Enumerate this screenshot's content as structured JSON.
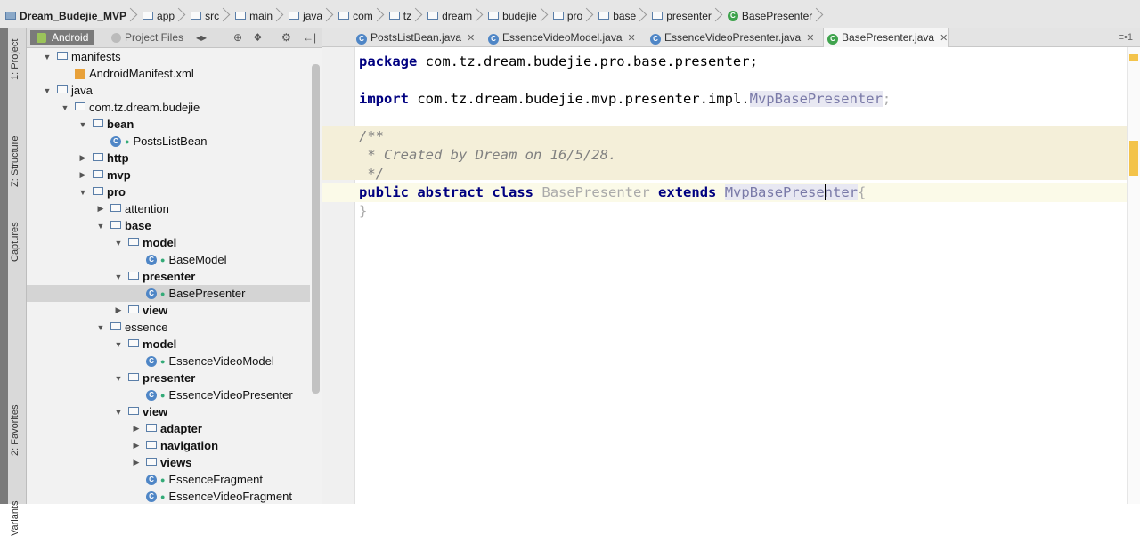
{
  "breadcrumb": {
    "items": [
      {
        "label": "Dream_Budejie_MVP",
        "icon": "project-folder-icon"
      },
      {
        "label": "app",
        "icon": "module-folder-icon"
      },
      {
        "label": "src",
        "icon": "folder-icon"
      },
      {
        "label": "main",
        "icon": "folder-icon"
      },
      {
        "label": "java",
        "icon": "folder-icon"
      },
      {
        "label": "com",
        "icon": "package-icon"
      },
      {
        "label": "tz",
        "icon": "package-icon"
      },
      {
        "label": "dream",
        "icon": "package-icon"
      },
      {
        "label": "budejie",
        "icon": "package-icon"
      },
      {
        "label": "pro",
        "icon": "package-icon"
      },
      {
        "label": "base",
        "icon": "package-icon"
      },
      {
        "label": "presenter",
        "icon": "package-icon"
      },
      {
        "label": "BasePresenter",
        "icon": "class-icon"
      }
    ]
  },
  "left_strip": {
    "tabs": [
      "1: Project",
      "Z: Structure",
      "Captures",
      "2: Favorites",
      "Variants"
    ]
  },
  "project_pane": {
    "view_tab": "Android",
    "other_tab": "Project Files",
    "tools": [
      "◂▸",
      "⊕",
      "❖",
      "⚙",
      "←|",
      "×"
    ]
  },
  "tree": [
    {
      "label": "manifests",
      "depth": 0,
      "expanded": true,
      "kind": "folder",
      "bold": false
    },
    {
      "label": "AndroidManifest.xml",
      "depth": 1,
      "kind": "file",
      "leaf": true
    },
    {
      "label": "java",
      "depth": 0,
      "expanded": true,
      "kind": "folder"
    },
    {
      "label": "com.tz.dream.budejie",
      "depth": 1,
      "expanded": true,
      "kind": "package"
    },
    {
      "label": "bean",
      "depth": 2,
      "expanded": true,
      "kind": "package",
      "bold": true
    },
    {
      "label": "PostsListBean",
      "depth": 3,
      "kind": "class",
      "leaf": true
    },
    {
      "label": "http",
      "depth": 2,
      "expanded": false,
      "kind": "package",
      "bold": true
    },
    {
      "label": "mvp",
      "depth": 2,
      "expanded": false,
      "kind": "package",
      "bold": true
    },
    {
      "label": "pro",
      "depth": 2,
      "expanded": true,
      "kind": "package",
      "bold": true
    },
    {
      "label": "attention",
      "depth": 3,
      "expanded": false,
      "kind": "package"
    },
    {
      "label": "base",
      "depth": 3,
      "expanded": true,
      "kind": "package",
      "bold": true
    },
    {
      "label": "model",
      "depth": 4,
      "expanded": true,
      "kind": "package",
      "bold": true
    },
    {
      "label": "BaseModel",
      "depth": 5,
      "kind": "class",
      "leaf": true
    },
    {
      "label": "presenter",
      "depth": 4,
      "expanded": true,
      "kind": "package",
      "bold": true
    },
    {
      "label": "BasePresenter",
      "depth": 5,
      "kind": "class",
      "leaf": true,
      "selected": true
    },
    {
      "label": "view",
      "depth": 4,
      "expanded": false,
      "kind": "package",
      "bold": true
    },
    {
      "label": "essence",
      "depth": 3,
      "expanded": true,
      "kind": "package"
    },
    {
      "label": "model",
      "depth": 4,
      "expanded": true,
      "kind": "package",
      "bold": true
    },
    {
      "label": "EssenceVideoModel",
      "depth": 5,
      "kind": "class",
      "leaf": true
    },
    {
      "label": "presenter",
      "depth": 4,
      "expanded": true,
      "kind": "package",
      "bold": true
    },
    {
      "label": "EssenceVideoPresenter",
      "depth": 5,
      "kind": "class",
      "leaf": true
    },
    {
      "label": "view",
      "depth": 4,
      "expanded": true,
      "kind": "package",
      "bold": true
    },
    {
      "label": "adapter",
      "depth": 5,
      "expanded": false,
      "kind": "package",
      "bold": true
    },
    {
      "label": "navigation",
      "depth": 5,
      "expanded": false,
      "kind": "package",
      "bold": true
    },
    {
      "label": "views",
      "depth": 5,
      "expanded": false,
      "kind": "package",
      "bold": true
    },
    {
      "label": "EssenceFragment",
      "depth": 5,
      "kind": "class",
      "leaf": true
    },
    {
      "label": "EssenceVideoFragment",
      "depth": 5,
      "kind": "class",
      "leaf": true
    }
  ],
  "editor_tabs": [
    {
      "label": "PostsListBean.java",
      "active": false
    },
    {
      "label": "EssenceVideoModel.java",
      "active": false
    },
    {
      "label": "EssenceVideoPresenter.java",
      "active": false
    },
    {
      "label": "BasePresenter.java",
      "active": true
    }
  ],
  "editor_tab_menu": "≡•1",
  "code": {
    "package_kw": "package",
    "package_name": " com.tz.dream.budejie.pro.base.presenter;",
    "import_kw": "import",
    "import_path": " com.tz.dream.budejie.mvp.presenter.impl.",
    "import_class": "MvpBasePresenter",
    "import_end": ";",
    "comment_1": "/**",
    "comment_2": " * Created by Dream on 16/5/28.",
    "comment_3": " */",
    "decl_public": "public",
    "decl_abstract": "abstract",
    "decl_class": "class",
    "decl_name": "BasePresenter",
    "decl_extends": "extends",
    "decl_super": "MvpBasePresenter",
    "decl_brace": "{",
    "closing_brace": "}"
  }
}
